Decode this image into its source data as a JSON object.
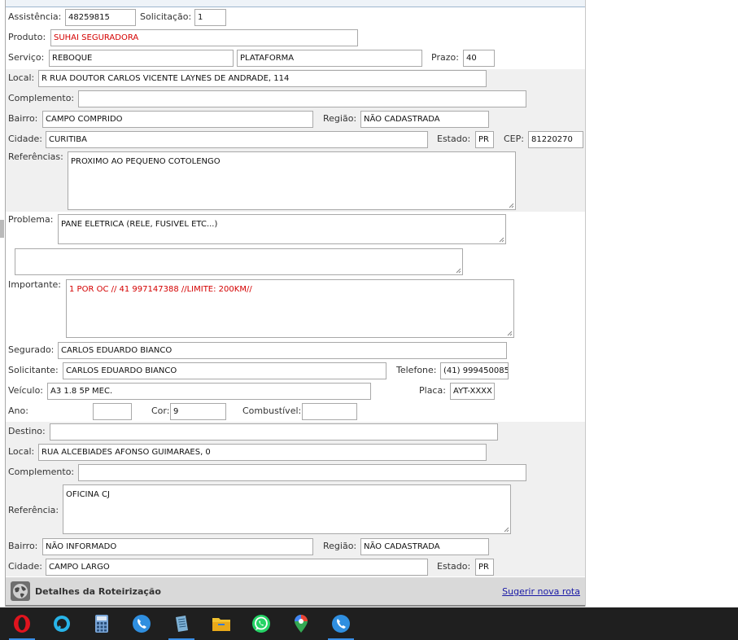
{
  "form": {
    "assistencia": {
      "label": "Assistência:",
      "value": "48259815"
    },
    "solicitacao": {
      "label": "Solicitação:",
      "value": "1"
    },
    "produto": {
      "label": "Produto:",
      "value": "SUHAI SEGURADORA"
    },
    "servico": {
      "label": "Serviço:",
      "value1": "REBOQUE",
      "value2": "PLATAFORMA"
    },
    "prazo": {
      "label": "Prazo:",
      "value": "40"
    },
    "origem": {
      "local": {
        "label": "Local:",
        "value": "R RUA DOUTOR CARLOS VICENTE LAYNES DE ANDRADE, 114"
      },
      "complemento": {
        "label": "Complemento:",
        "value": ""
      },
      "bairro": {
        "label": "Bairro:",
        "value": "CAMPO COMPRIDO"
      },
      "regiao": {
        "label": "Região:",
        "value": "NÃO CADASTRADA"
      },
      "cidade": {
        "label": "Cidade:",
        "value": "CURITIBA"
      },
      "estado": {
        "label": "Estado:",
        "value": "PR"
      },
      "cep": {
        "label": "CEP:",
        "value": "81220270"
      },
      "referencias": {
        "label": "Referências:",
        "value": "PROXIMO AO PEQUENO COTOLENGO"
      }
    },
    "problema": {
      "label": "Problema:",
      "value": "PANE ELETRICA (RELE, FUSIVEL ETC...)",
      "extra": ""
    },
    "importante": {
      "label": "Importante:",
      "value": "1 POR OC // 41 997147388  //LIMITE: 200KM//"
    },
    "segurado": {
      "label": "Segurado:",
      "value": "CARLOS EDUARDO BIANCO"
    },
    "solicitante": {
      "label": "Solicitante:",
      "value": "CARLOS EDUARDO BIANCO"
    },
    "telefone": {
      "label": "Telefone:",
      "value": "(41) 999450085"
    },
    "veiculo": {
      "label": "Veículo:",
      "value": "A3 1.8 5P MEC."
    },
    "placa": {
      "label": "Placa:",
      "value": "AYT-XXXX"
    },
    "ano": {
      "label": "Ano:",
      "value": ""
    },
    "cor": {
      "label": "Cor:",
      "value": "9"
    },
    "combustivel": {
      "label": "Combustível:",
      "value": ""
    },
    "destino": {
      "destino": {
        "label": "Destino:",
        "value": ""
      },
      "local": {
        "label": "Local:",
        "value": "RUA ALCEBIADES AFONSO GUIMARAES, 0"
      },
      "complemento": {
        "label": "Complemento:",
        "value": ""
      },
      "referencia": {
        "label": "Referência:",
        "value": "OFICINA CJ"
      },
      "bairro": {
        "label": "Bairro:",
        "value": "NÃO INFORMADO"
      },
      "regiao": {
        "label": "Região:",
        "value": "NÃO CADASTRADA"
      },
      "cidade": {
        "label": "Cidade:",
        "value": "CAMPO LARGO"
      },
      "estado": {
        "label": "Estado:",
        "value": "PR"
      }
    }
  },
  "footer": {
    "title": "Detalhes da Roteirização",
    "link": "Sugerir nova rota",
    "icon": "globe-icon"
  },
  "taskbar": {
    "apps": [
      {
        "name": "opera",
        "icon": "opera-icon",
        "color": "#e0141e"
      },
      {
        "name": "alexa",
        "icon": "alexa-icon",
        "color": "#28b4e8"
      },
      {
        "name": "calculator",
        "icon": "calculator-icon",
        "color": "#7aa6d8"
      },
      {
        "name": "phone",
        "icon": "phone-icon",
        "color": "#2f8fe0"
      },
      {
        "name": "notepad",
        "icon": "notepad-icon",
        "color": "#7fb2d6"
      },
      {
        "name": "file-explorer",
        "icon": "folder-icon",
        "color": "#f2c230"
      },
      {
        "name": "whatsapp",
        "icon": "whatsapp-icon",
        "color": "#25d366"
      },
      {
        "name": "maps",
        "icon": "maps-pin-icon",
        "color": "#ea4335"
      },
      {
        "name": "softphone",
        "icon": "phone-icon",
        "color": "#2f8fe0"
      }
    ]
  },
  "colors": {
    "accent_red": "#d40000",
    "band": "#f0f0f0",
    "footer_bg": "#d9d9d9",
    "link": "#1a1aa6"
  }
}
